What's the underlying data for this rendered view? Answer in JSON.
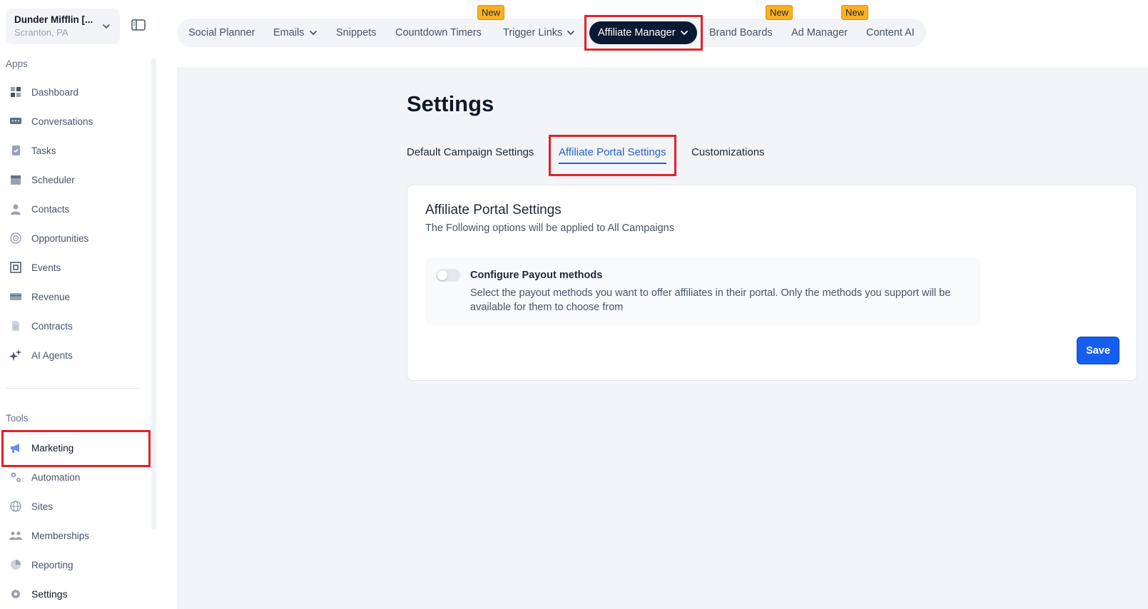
{
  "account": {
    "name": "Dunder Mifflin [...",
    "location": "Scranton, PA"
  },
  "sidebar": {
    "apps_label": "Apps",
    "tools_label": "Tools",
    "apps": [
      {
        "label": "Dashboard",
        "icon": "dashboard-icon"
      },
      {
        "label": "Conversations",
        "icon": "chat-icon"
      },
      {
        "label": "Tasks",
        "icon": "task-icon"
      },
      {
        "label": "Scheduler",
        "icon": "calendar-icon"
      },
      {
        "label": "Contacts",
        "icon": "person-icon"
      },
      {
        "label": "Opportunities",
        "icon": "target-icon"
      },
      {
        "label": "Events",
        "icon": "events-icon"
      },
      {
        "label": "Revenue",
        "icon": "card-icon"
      },
      {
        "label": "Contracts",
        "icon": "document-icon"
      },
      {
        "label": "AI Agents",
        "icon": "sparkle-icon"
      }
    ],
    "tools": [
      {
        "label": "Marketing",
        "icon": "megaphone-icon"
      },
      {
        "label": "Automation",
        "icon": "gears-icon"
      },
      {
        "label": "Sites",
        "icon": "globe-icon"
      },
      {
        "label": "Memberships",
        "icon": "group-icon"
      },
      {
        "label": "Reporting",
        "icon": "pie-icon"
      },
      {
        "label": "Settings",
        "icon": "gear-icon"
      }
    ]
  },
  "topnav": {
    "items": [
      {
        "label": "Social Planner"
      },
      {
        "label": "Emails"
      },
      {
        "label": "Snippets"
      },
      {
        "label": "Countdown Timers"
      },
      {
        "label": "Trigger Links"
      },
      {
        "label": "Affiliate Manager"
      },
      {
        "label": "Brand Boards"
      },
      {
        "label": "Ad Manager"
      },
      {
        "label": "Content AI"
      }
    ],
    "badge_label": "New"
  },
  "page": {
    "title": "Settings",
    "tabs": [
      {
        "label": "Default Campaign Settings"
      },
      {
        "label": "Affiliate Portal Settings"
      },
      {
        "label": "Customizations"
      }
    ]
  },
  "card": {
    "title": "Affiliate Portal Settings",
    "subtitle": "The Following options will be applied to All Campaigns",
    "option_title": "Configure Payout methods",
    "option_description": "Select the payout methods you want to offer affiliates in their portal. Only the methods you support will be available for them to choose from",
    "toggle_enabled": false,
    "save_label": "Save"
  },
  "colors": {
    "accent": "#155eef",
    "active_tab": "#2563c9",
    "active_nav_bg": "#0b1a33",
    "badge": "#fdb022",
    "highlight": "#e0222b"
  }
}
